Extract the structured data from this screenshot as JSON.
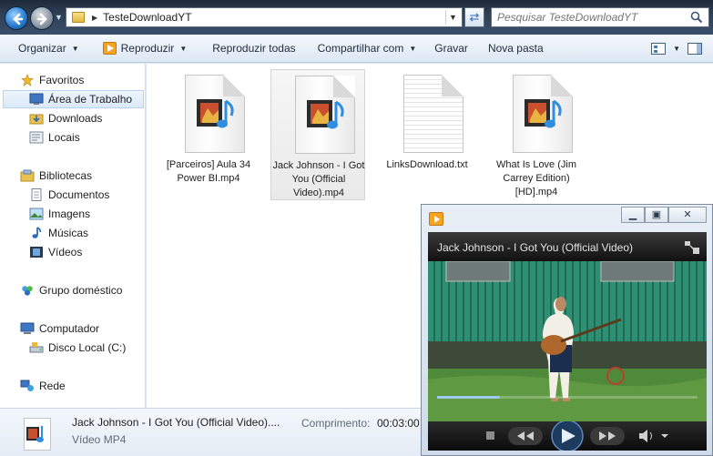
{
  "address": {
    "path": "TesteDownloadYT",
    "search_placeholder": "Pesquisar TesteDownloadYT"
  },
  "toolbar": {
    "organize": "Organizar",
    "play": "Reproduzir",
    "play_all": "Reproduzir todas",
    "share": "Compartilhar com",
    "burn": "Gravar",
    "new_folder": "Nova pasta"
  },
  "sidebar": {
    "favorites": "Favoritos",
    "desktop": "Área de Trabalho",
    "downloads": "Downloads",
    "locals": "Locais",
    "libraries": "Bibliotecas",
    "documents": "Documentos",
    "images": "Imagens",
    "music": "Músicas",
    "videos": "Vídeos",
    "homegroup": "Grupo doméstico",
    "computer": "Computador",
    "local_disk": "Disco Local (C:)",
    "network": "Rede"
  },
  "files": [
    {
      "name": "[Parceiros] Aula 34 Power BI.mp4",
      "icon": "video-file-icon",
      "selected": false
    },
    {
      "name": "Jack Johnson - I Got You (Official Video).mp4",
      "icon": "video-file-icon",
      "selected": true
    },
    {
      "name": "LinksDownload.txt",
      "icon": "text-file-icon",
      "selected": false
    },
    {
      "name": "What Is Love (Jim Carrey Edition) [HD].mp4",
      "icon": "video-file-icon",
      "selected": false
    }
  ],
  "details": {
    "name": "Jack Johnson - I Got You (Official Video)....",
    "type": "Vídeo MP4",
    "length_label": "Comprimento:",
    "length_value": "00:03:00"
  },
  "player": {
    "title": "Jack Johnson - I Got You (Official Video)",
    "progress": 0.24
  }
}
